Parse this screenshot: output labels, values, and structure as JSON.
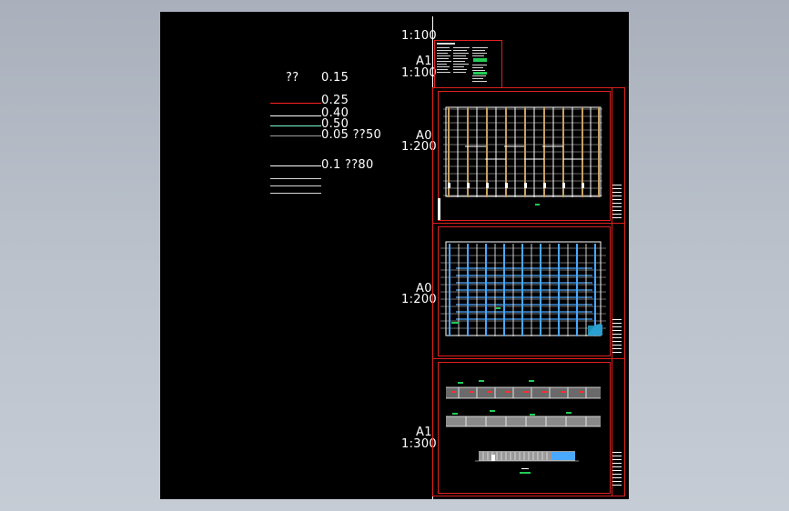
{
  "legend": {
    "header_glyph": "??",
    "header_value": "0.15",
    "rows": [
      {
        "label": "0.25",
        "color": "#ff2020"
      },
      {
        "label": "0.40",
        "color": "#ffffff"
      },
      {
        "label": "0.50",
        "color": "#7fffd0"
      },
      {
        "label": "0.05  ??50",
        "color": "#a0a0a0"
      },
      {
        "label": "0.1  ??80",
        "color": "#ffffff"
      }
    ]
  },
  "sheets": [
    {
      "size": "",
      "scale": "1:100"
    },
    {
      "size": "A1",
      "scale": "1:100"
    },
    {
      "size": "A0",
      "scale": "1:200"
    },
    {
      "size": "A0",
      "scale": "1:200"
    },
    {
      "size": "A1",
      "scale": "1:300"
    }
  ],
  "colors": {
    "background_outer": "#b5bcc6",
    "canvas": "#000000",
    "frame": "#e02020",
    "structure_tan": "#c8a064",
    "structure_blue": "#4aa8ff"
  }
}
